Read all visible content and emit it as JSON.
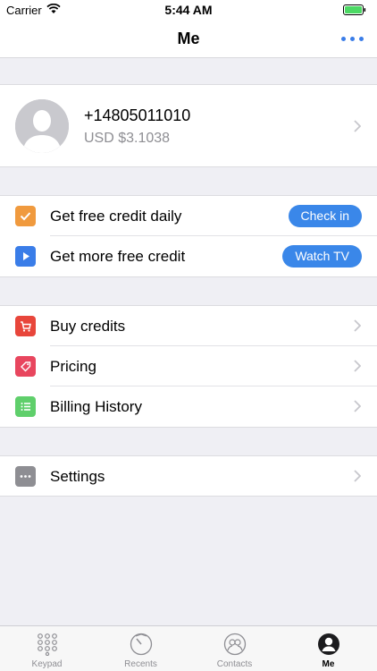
{
  "status_bar": {
    "carrier": "Carrier",
    "time": "5:44 AM"
  },
  "nav": {
    "title": "Me"
  },
  "profile": {
    "phone": "+14805011010",
    "balance": "USD $3.1038"
  },
  "rewards": [
    {
      "label": "Get free credit daily",
      "action": "Check in",
      "icon": "checkmark-icon",
      "color": "#f09a3e"
    },
    {
      "label": "Get more free credit",
      "action": "Watch TV",
      "icon": "play-icon",
      "color": "#3a7de8"
    }
  ],
  "billing": [
    {
      "label": "Buy credits",
      "icon": "cart-icon",
      "color": "#e8463b"
    },
    {
      "label": "Pricing",
      "icon": "price-tag-icon",
      "color": "#e8465e"
    },
    {
      "label": "Billing History",
      "icon": "list-icon",
      "color": "#5fcf6b"
    }
  ],
  "settings": {
    "label": "Settings",
    "icon": "ellipsis-icon",
    "color": "#8e8e93"
  },
  "tabs": [
    {
      "label": "Keypad",
      "icon": "keypad-icon"
    },
    {
      "label": "Recents",
      "icon": "clock-icon"
    },
    {
      "label": "Contacts",
      "icon": "contacts-icon"
    },
    {
      "label": "Me",
      "icon": "person-icon",
      "active": true
    }
  ]
}
